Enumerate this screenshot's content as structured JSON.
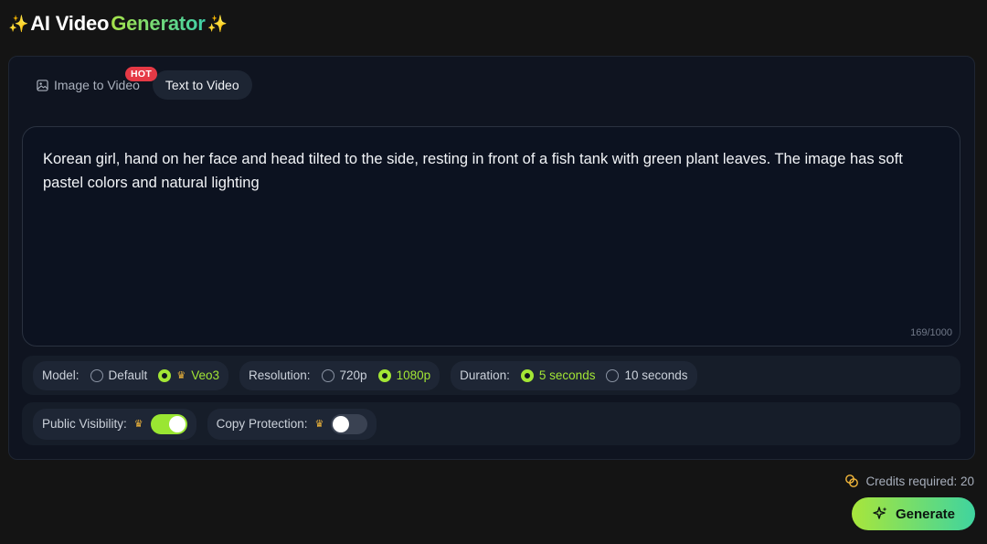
{
  "header": {
    "sparkle": "✨",
    "title_part1": "AI Video",
    "title_part2": "Generator"
  },
  "tabs": [
    {
      "label": "Image to Video",
      "icon": "image-icon",
      "active": false,
      "badge": "HOT"
    },
    {
      "label": "Text to Video",
      "active": true
    }
  ],
  "prompt": {
    "text": "Korean girl, hand on her face and head tilted to the side, resting in front of a fish tank with green plant leaves. The image has soft pastel colors and natural lighting",
    "counter": "169/1000"
  },
  "settings": {
    "model": {
      "label": "Model:",
      "options": [
        {
          "label": "Default",
          "selected": false
        },
        {
          "label": "Veo3",
          "selected": true,
          "premium": true
        }
      ]
    },
    "resolution": {
      "label": "Resolution:",
      "options": [
        {
          "label": "720p",
          "selected": false
        },
        {
          "label": "1080p",
          "selected": true
        }
      ]
    },
    "duration": {
      "label": "Duration:",
      "options": [
        {
          "label": "5 seconds",
          "selected": true
        },
        {
          "label": "10 seconds",
          "selected": false
        }
      ]
    },
    "public_visibility": {
      "label": "Public Visibility:",
      "premium": true,
      "on": true
    },
    "copy_protection": {
      "label": "Copy Protection:",
      "premium": true,
      "on": false
    }
  },
  "footer": {
    "credits": "Credits required: 20",
    "generate_label": "Generate"
  },
  "colors": {
    "accent": "#a3e635",
    "accent_end": "#3fd49f",
    "hot_badge": "#e53945",
    "premium": "#f5b93b"
  },
  "icons": {
    "premium": "crown-icon",
    "credits": "coins-icon",
    "generate": "sparkle-icon"
  }
}
